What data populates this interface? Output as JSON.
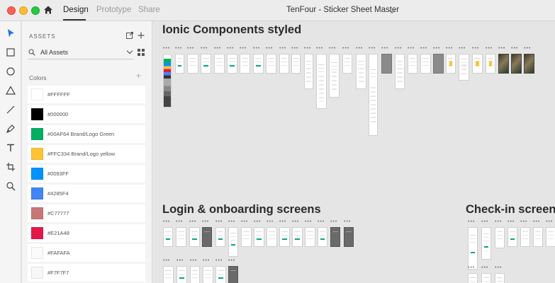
{
  "window": {
    "tabs": [
      {
        "label": "Design",
        "active": true
      },
      {
        "label": "Prototype",
        "active": false
      },
      {
        "label": "Share",
        "active": false
      }
    ],
    "document_title": "TenFour - Sticker Sheet Master"
  },
  "toolbar": {
    "tools": [
      "select-icon",
      "rectangle-icon",
      "ellipse-icon",
      "polygon-icon",
      "line-icon",
      "pen-icon",
      "text-icon",
      "artboard-icon",
      "zoom-icon"
    ]
  },
  "assets": {
    "title": "ASSETS",
    "filter_value": "All Assets",
    "colors_label": "Colors",
    "colors": [
      {
        "hex": "#FFFFFF",
        "label": "#FFFFFF"
      },
      {
        "hex": "#000000",
        "label": "#000000"
      },
      {
        "hex": "#00AF64",
        "label": "#00AF64 Brand/Logo Green"
      },
      {
        "hex": "#FFC334",
        "label": "#FFC334 Brand/Logo yellow"
      },
      {
        "hex": "#0093FF",
        "label": "#0093FF"
      },
      {
        "hex": "#4285F4",
        "label": "#4285F4"
      },
      {
        "hex": "#C77777",
        "label": "#C77777"
      },
      {
        "hex": "#E21A48",
        "label": "#E21A48"
      },
      {
        "hex": "#FAFAFA",
        "label": "#FAFAFA"
      },
      {
        "hex": "#F7F7F7",
        "label": "#F7F7F7"
      }
    ]
  },
  "canvas": {
    "sections": [
      {
        "title": "Ionic Components styled"
      },
      {
        "title": "Login & onboarding screens"
      },
      {
        "title": "Check-in screen"
      }
    ]
  }
}
